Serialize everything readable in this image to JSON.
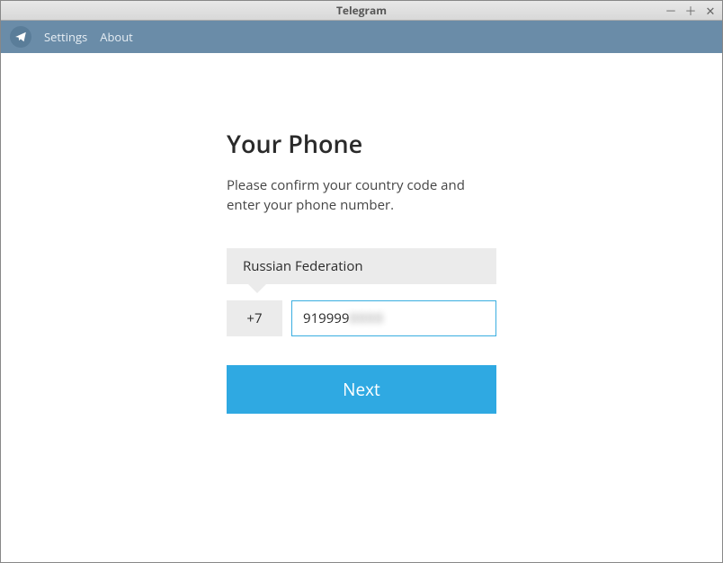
{
  "window": {
    "title": "Telegram"
  },
  "menubar": {
    "settings": "Settings",
    "about": "About"
  },
  "form": {
    "heading": "Your Phone",
    "subtext": "Please confirm your country code and enter your phone number.",
    "country": "Russian Federation",
    "code": "+7",
    "phone_visible": "919999",
    "phone_hidden": "0000",
    "next": "Next"
  }
}
